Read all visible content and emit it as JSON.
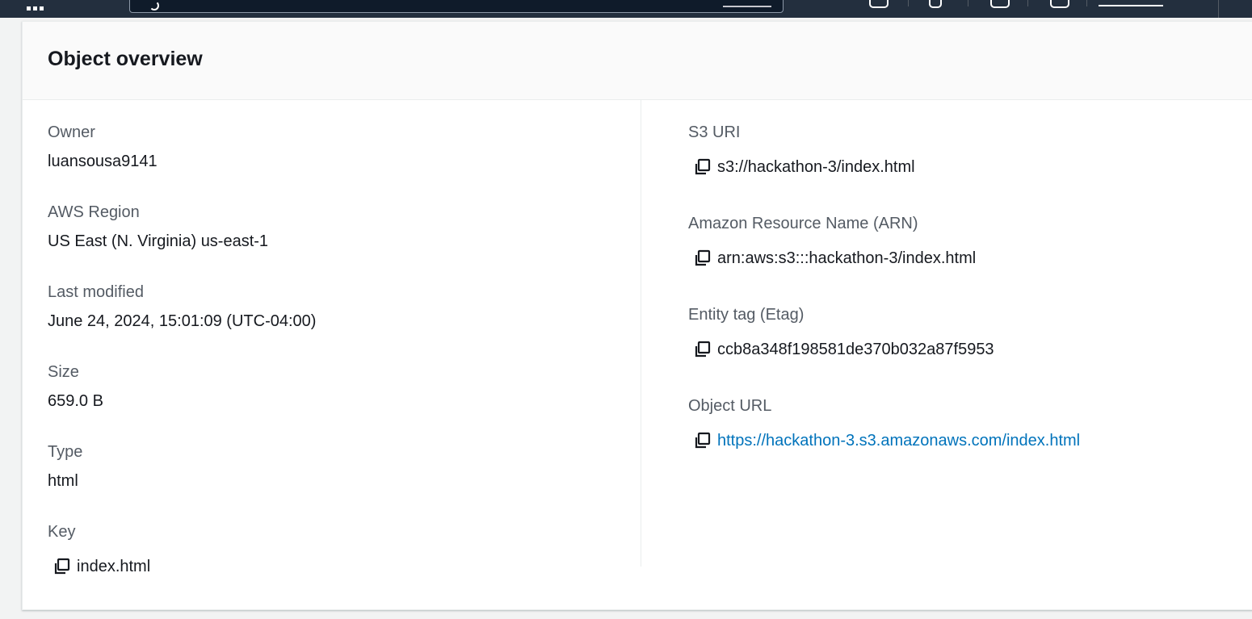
{
  "panel": {
    "title": "Object overview"
  },
  "left_fields": {
    "owner": {
      "label": "Owner",
      "value": "luansousa9141"
    },
    "region": {
      "label": "AWS Region",
      "value": "US East (N. Virginia) us-east-1"
    },
    "modified": {
      "label": "Last modified",
      "value": "June 24, 2024, 15:01:09 (UTC-04:00)"
    },
    "size": {
      "label": "Size",
      "value": "659.0 B"
    },
    "type": {
      "label": "Type",
      "value": "html"
    },
    "key": {
      "label": "Key",
      "value": "index.html"
    }
  },
  "right_fields": {
    "s3_uri": {
      "label": "S3 URI",
      "value": "s3://hackathon-3/index.html"
    },
    "arn": {
      "label": "Amazon Resource Name (ARN)",
      "value": "arn:aws:s3:::hackathon-3/index.html"
    },
    "etag": {
      "label": "Entity tag (Etag)",
      "value": "ccb8a348f198581de370b032a87f5953"
    },
    "object_url": {
      "label": "Object URL",
      "value": "https://hackathon-3.s3.amazonaws.com/index.html"
    }
  },
  "icons": {
    "copy": "copy-icon",
    "apps": "apps-grid-icon",
    "search": "search-icon"
  },
  "colors": {
    "nav_background": "#232f3e",
    "link": "#0073bb",
    "label": "#545b64",
    "text": "#16191f"
  }
}
